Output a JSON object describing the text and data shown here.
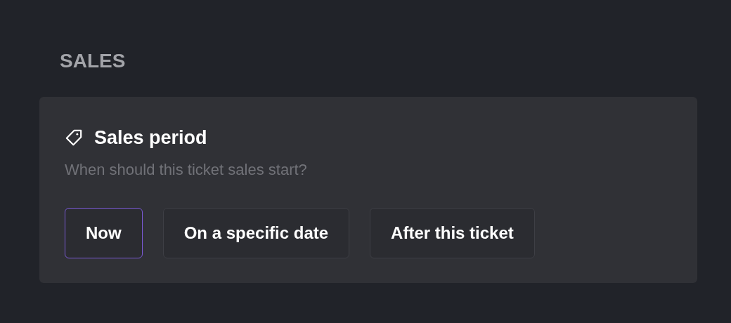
{
  "section": {
    "title": "SALES"
  },
  "card": {
    "title": "Sales period",
    "subtitle": "When should this ticket sales start?",
    "options": [
      {
        "label": "Now",
        "selected": true
      },
      {
        "label": "On a specific date",
        "selected": false
      },
      {
        "label": "After this ticket",
        "selected": false
      }
    ]
  }
}
